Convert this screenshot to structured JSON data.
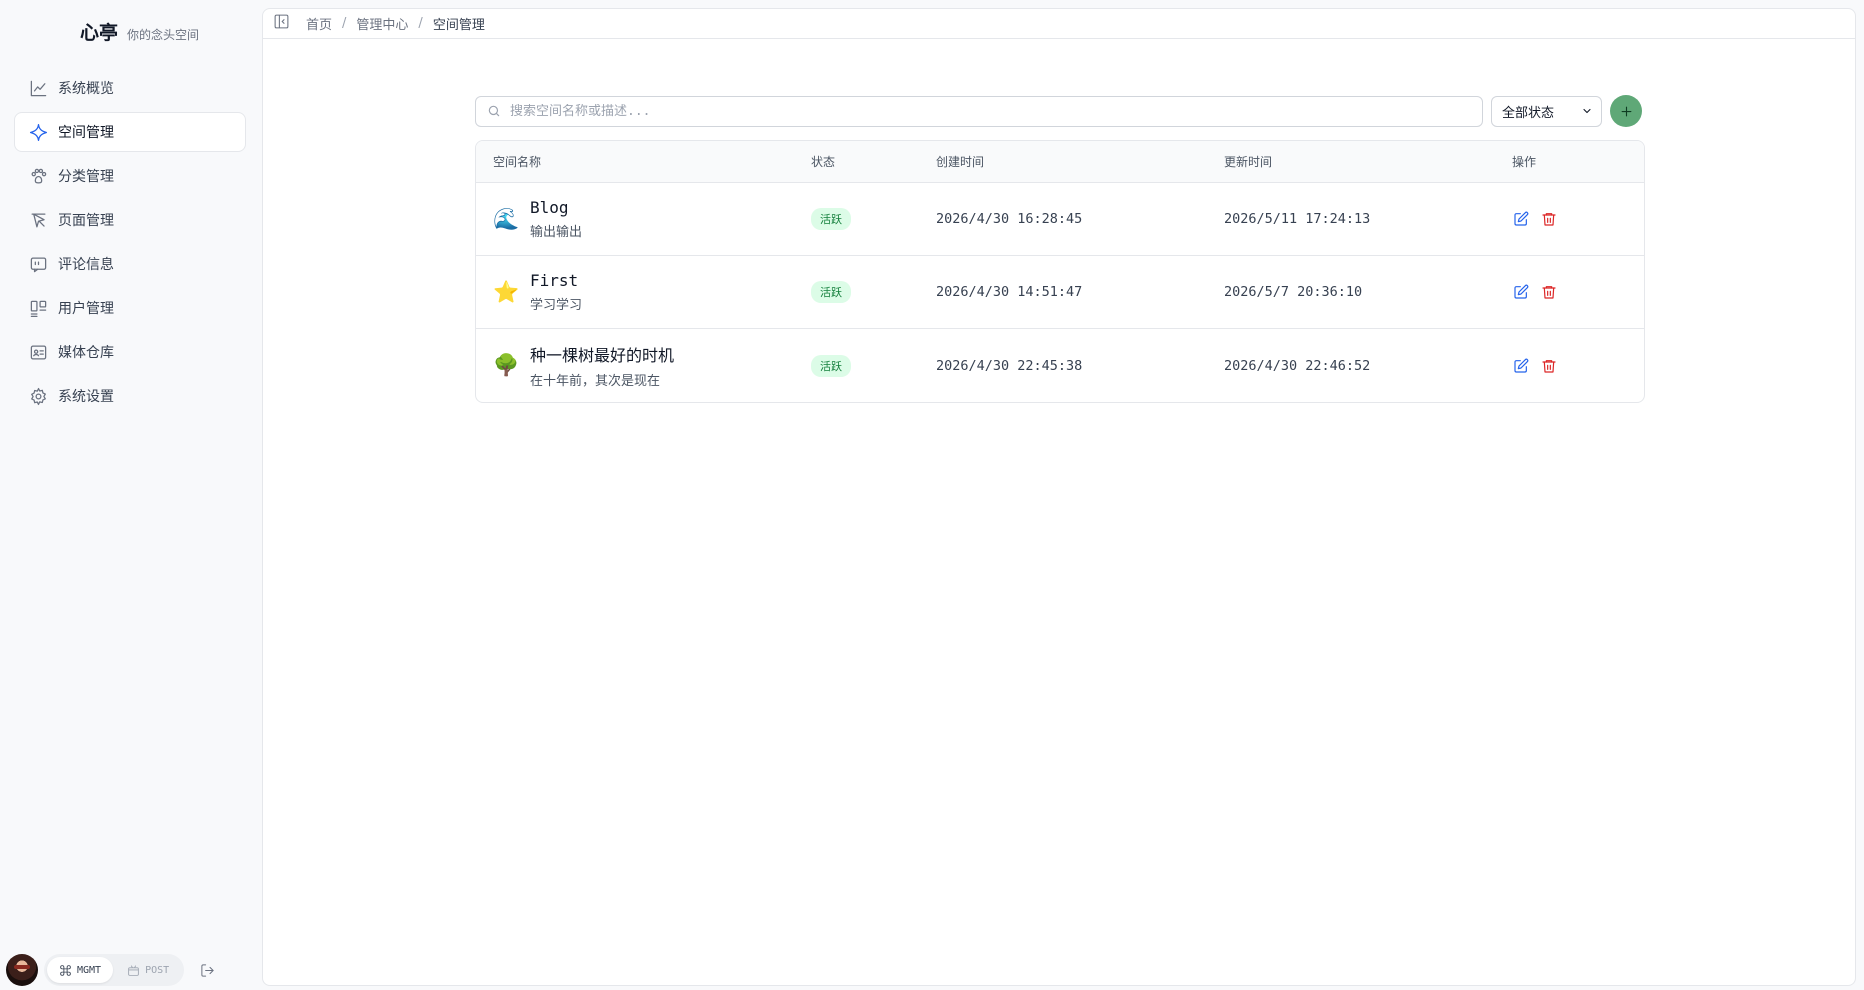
{
  "brand": {
    "title": "心亭",
    "subtitle": "你的念头空间"
  },
  "sidebar": {
    "items": [
      {
        "label": "系统概览",
        "icon": "chart-line-icon"
      },
      {
        "label": "空间管理",
        "icon": "sparkle-icon",
        "active": true
      },
      {
        "label": "分类管理",
        "icon": "paw-icon"
      },
      {
        "label": "页面管理",
        "icon": "brush-icon"
      },
      {
        "label": "评论信息",
        "icon": "quote-icon"
      },
      {
        "label": "用户管理",
        "icon": "layout-icon"
      },
      {
        "label": "媒体仓库",
        "icon": "id-card-icon"
      },
      {
        "label": "系统设置",
        "icon": "gear-icon"
      }
    ],
    "footer": {
      "mode_mgmt": "MGMT",
      "mode_post": "POST"
    }
  },
  "breadcrumb": {
    "home": "首页",
    "center": "管理中心",
    "current": "空间管理"
  },
  "toolbar": {
    "search_placeholder": "搜索空间名称或描述...",
    "status_filter": "全部状态"
  },
  "table": {
    "headers": {
      "name": "空间名称",
      "status": "状态",
      "created": "创建时间",
      "updated": "更新时间",
      "ops": "操作"
    },
    "rows": [
      {
        "emoji": "🌊",
        "name": "Blog",
        "desc": "输出输出",
        "status": "活跃",
        "created": "2026/4/30 16:28:45",
        "updated": "2026/5/11 17:24:13"
      },
      {
        "emoji": "⭐",
        "name": "First",
        "desc": "学习学习",
        "status": "活跃",
        "created": "2026/4/30 14:51:47",
        "updated": "2026/5/7 20:36:10"
      },
      {
        "emoji": "🌳",
        "name": "种一棵树最好的时机",
        "desc": "在十年前，其次是现在",
        "status": "活跃",
        "created": "2026/4/30 22:45:38",
        "updated": "2026/4/30 22:46:52"
      }
    ]
  },
  "colors": {
    "accent": "#2563eb",
    "success_bg": "#dcfce7",
    "success_text": "#15803d",
    "add_button": "#5fa877",
    "danger": "#dc2626"
  }
}
